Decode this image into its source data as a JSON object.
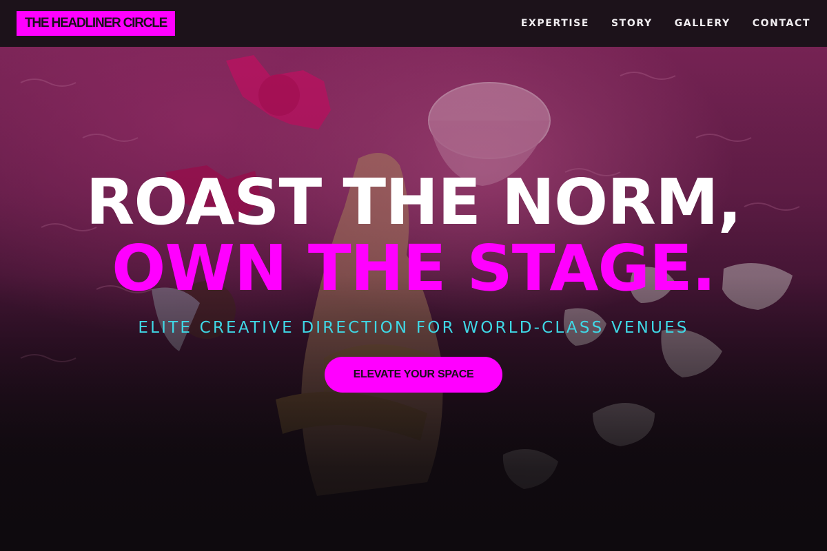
{
  "header": {
    "logo_text": "THE HEADLINER CIRCLE",
    "nav": [
      {
        "label": "EXPERTISE"
      },
      {
        "label": "STORY"
      },
      {
        "label": "GALLERY"
      },
      {
        "label": "CONTACT"
      }
    ]
  },
  "hero": {
    "headline_line1": "ROAST THE NORM,",
    "headline_line2": "OWN THE STAGE.",
    "tagline": "ELITE CREATIVE DIRECTION FOR WORLD-CLASS VENUES",
    "cta_label": "ELEVATE YOUR SPACE",
    "background_image": "pink-shag-rug-petals-hand-glass"
  },
  "colors": {
    "accent_magenta": "#ff00ff",
    "accent_cyan": "#3fd8e6",
    "nav_bg": "#181218",
    "text_white": "#ffffff"
  }
}
